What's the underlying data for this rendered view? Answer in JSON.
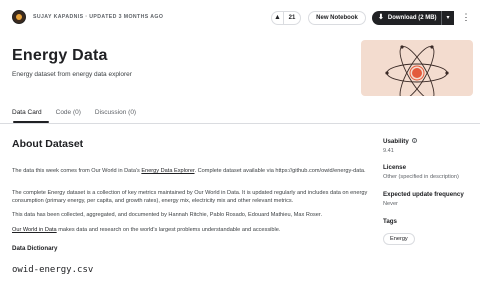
{
  "header": {
    "meta": "SUJAY KAPADNIS · UPDATED 3 MONTHS AGO",
    "vote_icon": "up-arrow-icon",
    "vote_symbol": "▲",
    "vote_count": "21",
    "new_notebook_label": "New Notebook",
    "download_icon": "download-icon",
    "download_symbol": "⬇",
    "download_label": "Download (2 MB)",
    "download_caret": "▾",
    "more_symbol": "⋮"
  },
  "dataset": {
    "title": "Energy Data",
    "subtitle": "Energy dataset from energy data explorer"
  },
  "tabs": [
    {
      "label": "Data Card"
    },
    {
      "label": "Code (0)"
    },
    {
      "label": "Discussion (0)"
    }
  ],
  "about": {
    "heading": "About Dataset",
    "p1_before": "The data this week comes from Our World in Data's ",
    "p1_link": "Energy Data Explorer",
    "p1_after": ". Complete dataset available via https://github.com/owid/energy-data.",
    "p2": "The complete Energy dataset is a collection of key metrics maintained by Our World in Data. It is updated regularly and includes data on energy consumption (primary energy, per capita, and growth rates), energy mix, electricity mix and other relevant metrics.",
    "p3": "This data has been collected, aggregated, and documented by Hannah Ritchie, Pablo Rosado, Edouard Mathieu, Max Roser.",
    "p4_link": "Our World in Data",
    "p4_after": " makes data and research on the world's largest problems understandable and accessible.",
    "dictionary_heading": "Data Dictionary",
    "file_name": "owid-energy.csv"
  },
  "sidebar": {
    "usability_label": "Usability",
    "usability_info": "i",
    "usability_value": "9.41",
    "license_label": "License",
    "license_value": "Other (specified in description)",
    "frequency_label": "Expected update frequency",
    "frequency_value": "Never",
    "tags_label": "Tags",
    "tags": [
      "Energy"
    ]
  },
  "colors": {
    "hero_bg": "#f3dccf",
    "atom_orbit": "#3a2a26",
    "atom_nucleus": "#e35a3c",
    "atom_nucleus_ring": "#e35a3c",
    "dark_button": "#202124"
  }
}
